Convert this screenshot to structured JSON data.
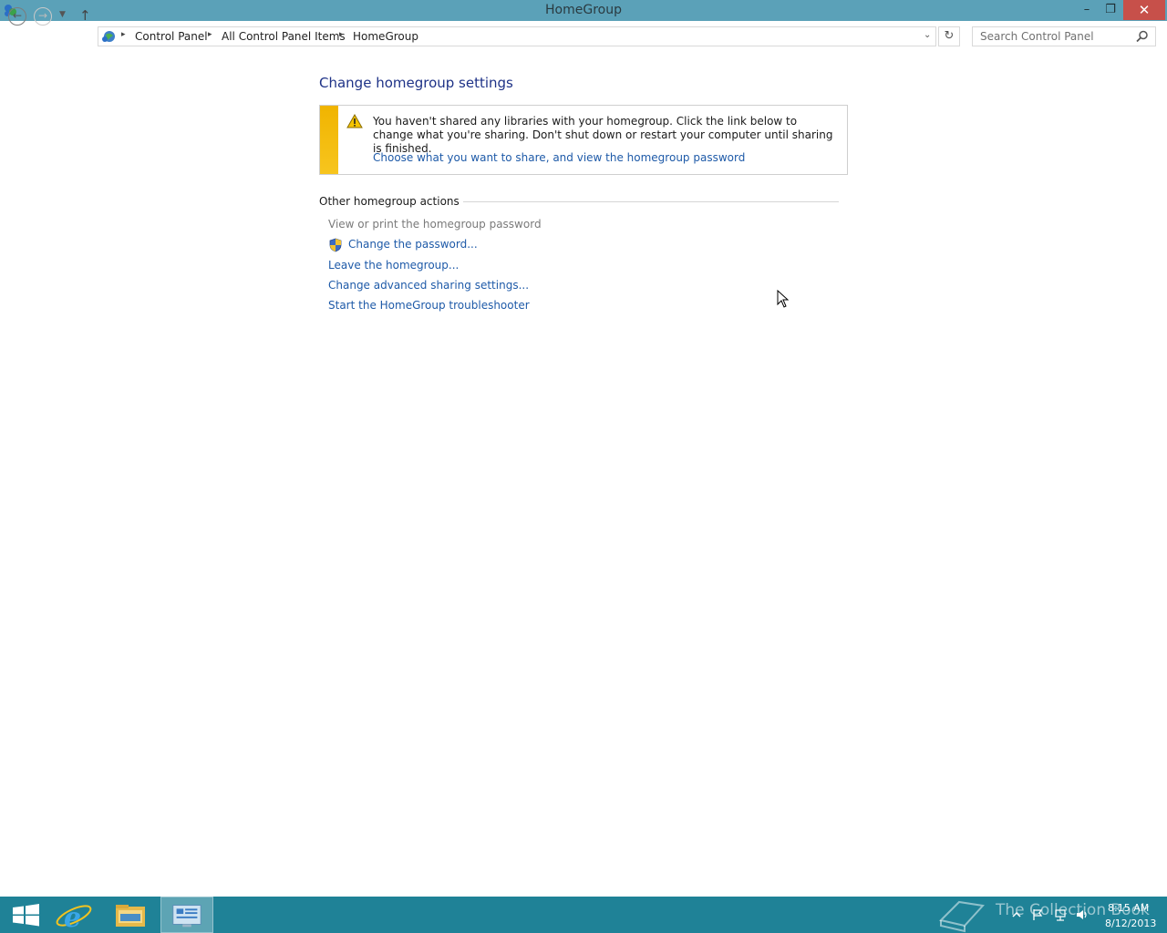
{
  "window": {
    "title": "HomeGroup",
    "minimize_glyph": "–",
    "maximize_glyph": "❐",
    "close_glyph": "✕"
  },
  "navigation": {
    "back_glyph": "←",
    "forward_glyph": "→",
    "recent_glyph": "▼",
    "up_glyph": "↑",
    "refresh_glyph": "↻",
    "dropdown_glyph": "⌵",
    "separator_glyph": "▸",
    "breadcrumbs": [
      "Control Panel",
      "All Control Panel Items",
      "HomeGroup"
    ],
    "search_placeholder": "Search Control Panel"
  },
  "content": {
    "heading": "Change homegroup settings",
    "notice": {
      "text": "You haven't shared any libraries with your homegroup. Click the link below to change what you're sharing. Don't shut down or restart your computer until sharing is finished.",
      "link": "Choose what you want to share, and view the homegroup password",
      "stripe_color": "#f0b400"
    },
    "section_title": "Other homegroup actions",
    "actions": [
      {
        "label": "View or print the homegroup password",
        "enabled": false
      },
      {
        "label": "Change the password...",
        "enabled": true,
        "icon": "uac-shield-icon"
      },
      {
        "label": "Leave the homegroup...",
        "enabled": true
      },
      {
        "label": "Change advanced sharing settings...",
        "enabled": true
      },
      {
        "label": "Start the HomeGroup troubleshooter",
        "enabled": true
      }
    ]
  },
  "taskbar": {
    "pinned": [
      "windows-logo-icon",
      "internet-explorer-icon",
      "file-explorer-icon",
      "control-panel-icon"
    ],
    "active": "control-panel-icon",
    "watermark": "The Collection Book",
    "time": "8:15 AM",
    "date": "8/12/2013"
  },
  "colors": {
    "title_bar": "#5ba1b8",
    "taskbar": "#1f8297",
    "link": "#1e5aa8",
    "heading": "#1e3287",
    "close_button": "#c7504a"
  }
}
